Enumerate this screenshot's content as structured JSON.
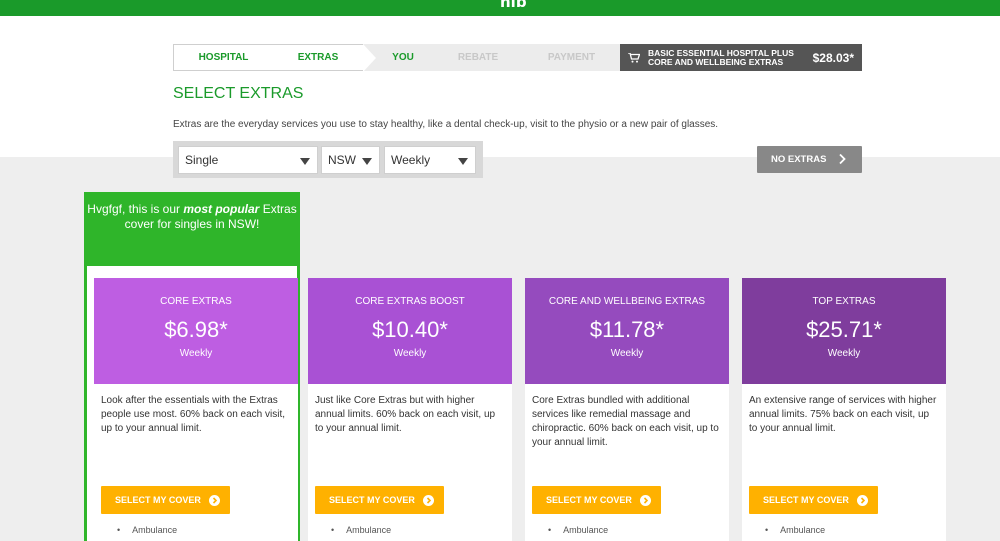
{
  "header": {
    "logo": "nib"
  },
  "steps": [
    {
      "label": "HOSPITAL"
    },
    {
      "label": "EXTRAS"
    },
    {
      "label": "YOU"
    },
    {
      "label": "REBATE"
    },
    {
      "label": "PAYMENT"
    }
  ],
  "cart": {
    "label_line1": "BASIC ESSENTIAL HOSPITAL PLUS",
    "label_line2": "CORE AND WELLBEING EXTRAS",
    "price": "$28.03*"
  },
  "page": {
    "title": "SELECT EXTRAS",
    "subtitle": "Extras are the everyday services you use to stay healthy, like a dental check-up, visit to the physio or a new pair of glasses."
  },
  "filters": {
    "cover_type": "Single",
    "state": "NSW",
    "frequency": "Weekly"
  },
  "no_extras_label": "NO EXTRAS",
  "popular": {
    "name": "Hvgfgf",
    "line1_pre": ", this is our ",
    "line1_em": "most popular",
    "line1_post": " Extras",
    "line2": "cover for singles in NSW!"
  },
  "colors": {
    "brand_green": "#1a9a2a",
    "popular_green": "#2fb52a",
    "button_yellow": "#ffb100"
  },
  "plans": [
    {
      "name": "CORE EXTRAS",
      "price": "$6.98*",
      "frequency": "Weekly",
      "color": "#be5ee2",
      "description": "Look after the essentials with the Extras people use most. 60% back on each visit, up to your annual limit.",
      "button": "SELECT MY COVER",
      "first_item": "Ambulance"
    },
    {
      "name": "CORE EXTRAS BOOST",
      "price": "$10.40*",
      "frequency": "Weekly",
      "color": "#a951d4",
      "description": "Just like Core Extras but with higher annual limits. 60% back on each visit, up to your annual limit.",
      "button": "SELECT MY COVER",
      "first_item": "Ambulance"
    },
    {
      "name": "CORE AND WELLBEING EXTRAS",
      "price": "$11.78*",
      "frequency": "Weekly",
      "color": "#954bbe",
      "description": "Core Extras bundled with additional services like remedial massage and chiropractic. 60% back on each visit, up to your annual limit.",
      "button": "SELECT MY COVER",
      "first_item": "Ambulance"
    },
    {
      "name": "TOP EXTRAS",
      "price": "$25.71*",
      "frequency": "Weekly",
      "color": "#7f3d9d",
      "description": "An extensive range of services with higher annual limits. 75% back on each visit, up to your annual limit.",
      "button": "SELECT MY COVER",
      "first_item": "Ambulance"
    }
  ]
}
